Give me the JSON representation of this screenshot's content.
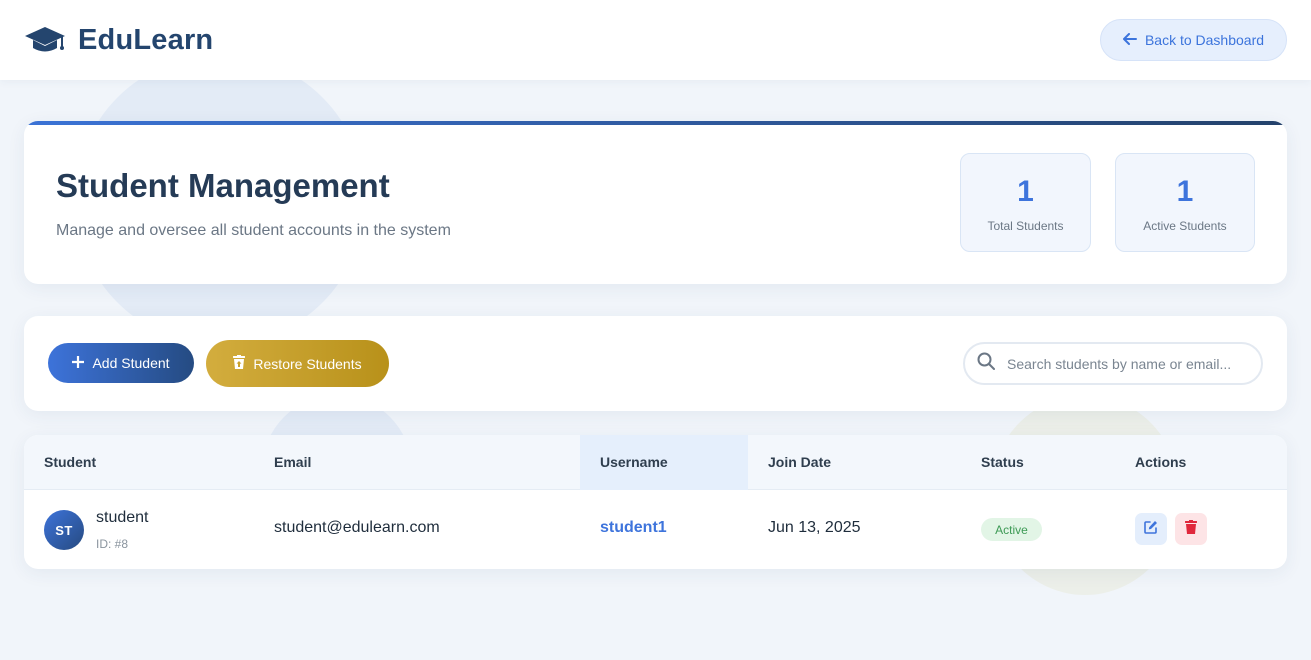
{
  "brand": {
    "name": "EduLearn",
    "icon": "graduation-cap-icon"
  },
  "nav": {
    "back_label": "Back to Dashboard",
    "back_icon": "arrow-left-icon"
  },
  "header": {
    "title": "Student Management",
    "subtitle": "Manage and oversee all student accounts in the system",
    "stats": [
      {
        "value": "1",
        "label": "Total Students"
      },
      {
        "value": "1",
        "label": "Active Students"
      }
    ]
  },
  "toolbar": {
    "add_label": "Add Student",
    "add_icon": "plus-icon",
    "restore_label": "Restore Students",
    "restore_icon": "trash-restore-icon",
    "search_placeholder": "Search students by name or email...",
    "search_icon": "search-icon"
  },
  "table": {
    "columns": [
      "Student",
      "Email",
      "Username",
      "Join Date",
      "Status",
      "Actions"
    ],
    "rows": [
      {
        "initials": "ST",
        "name": "student",
        "id": "ID: #8",
        "email": "student@edulearn.com",
        "username": "student1",
        "join_date": "Jun 13, 2025",
        "status": "Active",
        "actions": [
          "edit-icon",
          "delete-icon"
        ]
      }
    ]
  },
  "colors": {
    "brand": "#24456e",
    "accent": "#3e74dc",
    "restore": "#c9a22e",
    "success": "#3d9a55",
    "danger": "#e0283c"
  }
}
